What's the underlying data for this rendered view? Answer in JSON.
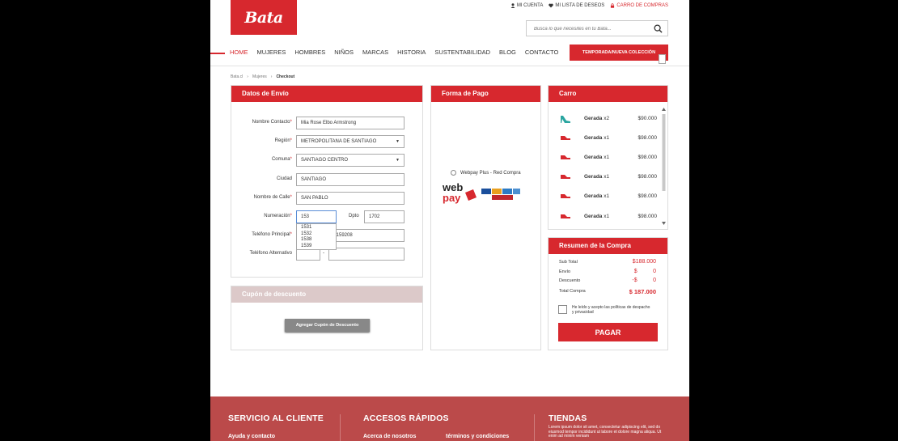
{
  "header": {
    "logo_text": "Bata",
    "top_links": [
      {
        "icon": "user-icon",
        "label": "MI CUENTA"
      },
      {
        "icon": "heart-icon",
        "label": "MI LISTA DE DESEOS"
      },
      {
        "icon": "lock-icon",
        "label": "CARRO DE COMPRAS"
      }
    ],
    "search_placeholder": "Busca lo que necesites en tu Bata...",
    "accent_color": "#d7282e"
  },
  "nav": {
    "items": [
      "HOME",
      "MUJERES",
      "HOMBRES",
      "NIÑOS",
      "MARCAS",
      "HISTORIA",
      "SUSTENTABILIDAD",
      "BLOG",
      "CONTACTO"
    ],
    "active_index": 0,
    "collection_button": "TEMPORADA/NUEVA COLECCIÓN"
  },
  "breadcrumb": [
    "Bata.cl",
    "Mujeres",
    "Checkout"
  ],
  "shipping": {
    "title": "Datos de Envío",
    "fields": [
      {
        "label": "Nombre Contacto",
        "required": true,
        "value": "Mia Rose Elbo Armstrong"
      },
      {
        "label": "Región",
        "required": true,
        "value": "METROPOLITANA DE SANTIAGO"
      },
      {
        "label": "Comuna",
        "required": true,
        "value": "SANTIAGO CENTRO"
      },
      {
        "label": "Ciudad",
        "required": false,
        "value": "SANTIAGO"
      },
      {
        "label": "Nombre de Calle",
        "required": true,
        "value": "SAN PABLO"
      },
      {
        "label": "Numeración",
        "required": true,
        "value": "153"
      },
      {
        "label": "Teléfono Principal",
        "required": true,
        "value": "76159208"
      },
      {
        "label": "Teléfono Alternativo",
        "required": false,
        "value": ""
      }
    ],
    "dpto_label": "Dpto",
    "dpto_value": "1702",
    "phone_separator": "-",
    "autocomplete": [
      "1531",
      "1532",
      "1538",
      "1539"
    ]
  },
  "coupon": {
    "title": "Cupón de descuento",
    "button": "Agregar Cupón de Descuento"
  },
  "payment": {
    "title": "Forma de Pago",
    "option": "Webpay Plus - Red Compra",
    "logo_text": "web pay"
  },
  "cart": {
    "title": "Carro",
    "items": [
      {
        "name": "Gerada",
        "qty": "x2",
        "price": "$90.000"
      },
      {
        "name": "Gerada",
        "qty": "x1",
        "price": "$98.000"
      },
      {
        "name": "Gerada",
        "qty": "x1",
        "price": "$98.000"
      },
      {
        "name": "Gerada",
        "qty": "x1",
        "price": "$98.000"
      },
      {
        "name": "Gerada",
        "qty": "x1",
        "price": "$98.000"
      },
      {
        "name": "Gerada",
        "qty": "x1",
        "price": "$98.000"
      }
    ]
  },
  "summary": {
    "title": "Resumen de la Compra",
    "rows": [
      {
        "label": "Sub Total",
        "value": "$188.000"
      },
      {
        "label": "Envío",
        "value": "$          0"
      },
      {
        "label": "Descuento",
        "value": "-$          0"
      },
      {
        "label": "Total Compra",
        "value": "$ 187.000"
      }
    ],
    "terms": "He leído y acepto las políticas de despacho y privacidad",
    "pay_button": "PAGAR"
  },
  "footer": {
    "sections": [
      "SERVICIO AL CLIENTE",
      "ACCESOS RÁPIDOS",
      "TIENDAS"
    ],
    "links": [
      "Ayuda y contacto",
      "Acerca de nosotros",
      "términos y condiciones"
    ],
    "lorem": "Lorem ipsum dolor sit amet, consectetur adipiscing elit, sed do eiusmod tempor incididunt ut labore et dolore magna aliqua. Ut enim ad minim veniam"
  }
}
